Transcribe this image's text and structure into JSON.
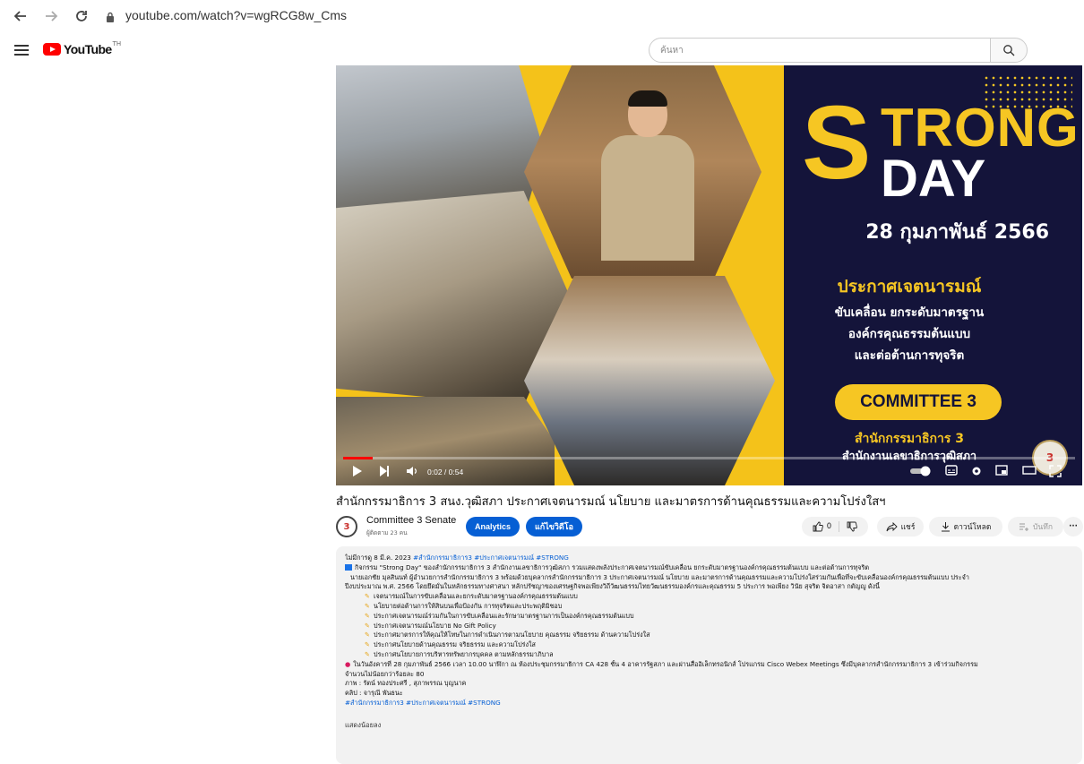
{
  "browser": {
    "url": "youtube.com/watch?v=wgRCG8w_Cms"
  },
  "header": {
    "logo_text": "YouTube",
    "region": "TH",
    "search_placeholder": "ค้นหา"
  },
  "video": {
    "headline_S": "S",
    "headline_rest": "TRONG",
    "headline_day": "DAY",
    "date": "28 กุมภาพันธ์ 2566",
    "declaration": "ประกาศเจตนารมณ์",
    "declaration_lines": [
      "ขับเคลื่อน ยกระดับมาตรฐาน",
      "องค์กรคุณธรรมต้นแบบ",
      "และต่อต้านการทุจริต"
    ],
    "committee": "COMMITTEE 3",
    "office_line1": "สำนักกรรมาธิการ 3",
    "office_line2": "สำนักงานเลขาธิการวุฒิสภา",
    "badge": "3",
    "time": "0:02 / 0:54",
    "progress": 0.04
  },
  "info": {
    "title": "สำนักกรรมาธิการ 3 สนง.วุฒิสภา ประกาศเจตนารมณ์ นโยบาย และมาตรการด้านคุณธรรมและความโปร่งใสฯ",
    "channel_name": "Committee 3 Senate",
    "subscribers": "ผู้ติดตาม 23 คน",
    "analytics_label": "Analytics",
    "edit_label": "แก้ไขวิดีโอ",
    "likes": "0",
    "share_label": "แชร์",
    "download_label": "ดาวน์โหลด",
    "save_label": "บันทึก",
    "more_label": "···"
  },
  "description": {
    "meta": "ไม่มีการดู 8 มี.ค. 2023",
    "meta_tags": "#สำนักกรรมาธิการ3 #ประกาศเจตนารมณ์ #STRONG",
    "para1": "กิจกรรม \"Strong Day\" ของสำนักกรรมาธิการ 3 สำนักงานเลขาธิการวุฒิสภา รวมแสดงพลังประกาศเจตนารมณ์ขับเคลื่อน ยกระดับมาตรฐานองค์กรคุณธรรมต้นแบบ และต่อต้านการทุจริต",
    "para2": "นายเอกชัย มุลสินนท์ ผู้อำนวยการสำนักกรรมาธิการ 3 พร้อมด้วยบุคลากรสำนักกรรมาธิการ 3 ประกาศเจตนารมณ์ นโยบาย และมาตรการด้านคุณธรรมและความโปร่งใสร่วมกันเพื่อที่จะขับเคลื่อนองค์กรคุณธรรมต้นแบบ ประจำ",
    "para3": "ปีงบประมาณ พ.ศ. 2566 โดยยึดมั่นในหลักธรรมทางศาสนา หลักปรัชญาของเศรษฐกิจพอเพียงวิถีวัฒนธรรมไทยวัฒนธรรมองค์กรและคุณธรรม 5 ประการ พอเพียง วินัย สุจริต จิตอาสา กตัญญู ดังนี้",
    "items": [
      "เจตนารมณ์ในการขับเคลื่อนและยกระดับมาตรฐานองค์กรคุณธรรมต้นแบบ",
      "นโยบายต่อต้านการให้สินบนเพื่อป้องกัน การทุจริตและประพฤติมิชอบ",
      "ประกาศเจตนารมณ์ร่วมกันในการขับเคลื่อนและรักษามาตรฐานการเป็นองค์กรคุณธรรมต้นแบบ",
      "ประกาศเจตนารมณ์นโยบาย No Gift Policy",
      "ประกาศมาตรการให้คุณให้โทษในการดำเนินการตามนโยบาย คุณธรรม จริยธรรม ด้านความโปร่งใส",
      "ประกาศนโยบายด้านคุณธรรม จริยธรรม และความโปร่งใส",
      "ประกาศนโยบายการบริหารทรัพยากรบุคคล ตามหลักธรรมาภิบาล"
    ],
    "para4": "ในวันอังคารที่ 28 กุมภาพันธ์ 2566 เวลา 10.00 นาฬิกา ณ ห้องประชุมกรรมาธิการ CA 428 ชั้น 4 อาคารรัฐสภา และผ่านสื่ออิเล็กทรอนิกส์ โปรแกรม Cisco Webex Meetings ซึ่งมีบุคลากรสำนักกรรมาธิการ 3 เข้าร่วมกิจกรรม",
    "para5": "จำนวนไม่น้อยกว่าร้อยละ 80",
    "photo_credit": "ภาพ : รัตน์ ทองประศรี , สุภาพรรณ บุญนาค",
    "clip_credit": "คลิป : จารุณี พันธนะ",
    "footer_tags": "#สำนักกรรมาธิการ3 #ประกาศเจตนารมณ์ #STRONG",
    "show_less": "แสดงน้อยลง"
  },
  "colors": {
    "yt_red": "#ff0000",
    "accent_blue": "#065fd4",
    "thumb_navy": "#14143a",
    "thumb_yellow": "#f6c623"
  }
}
